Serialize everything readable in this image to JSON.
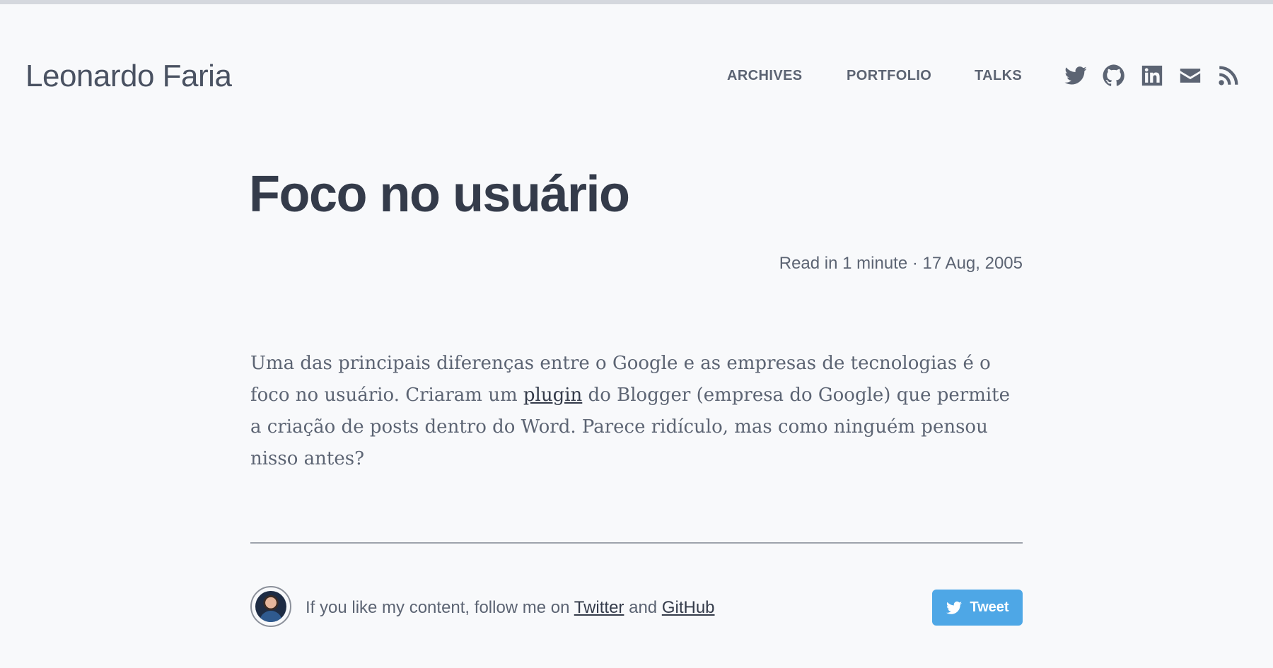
{
  "site": {
    "title": "Leonardo Faria"
  },
  "nav": [
    {
      "label": "ARCHIVES"
    },
    {
      "label": "PORTFOLIO"
    },
    {
      "label": "TALKS"
    }
  ],
  "social_icons": [
    "twitter-icon",
    "github-icon",
    "linkedin-icon",
    "email-icon",
    "rss-icon"
  ],
  "post": {
    "title": "Foco no usuário",
    "meta": "Read in 1 minute · 17 Aug, 2005",
    "body_before_link": "Uma das principais diferenças entre o Google e as empresas de tecnologias é o foco no usuário. Criaram um ",
    "link_text": "plugin",
    "body_after_link": " do Blogger (empresa do Google) que permite a criação de posts dentro do Word. Parece ridículo, mas como ninguém pensou nisso antes?"
  },
  "footer": {
    "follow_prefix": "If you like my content, follow me on ",
    "twitter_link": "Twitter",
    "and_text": " and ",
    "github_link": "GitHub",
    "tweet_label": "Tweet"
  },
  "colors": {
    "background": "#f8f9fb",
    "text": "#5c6473",
    "heading": "#343b4a",
    "tweet_button": "#4ea7e6"
  }
}
